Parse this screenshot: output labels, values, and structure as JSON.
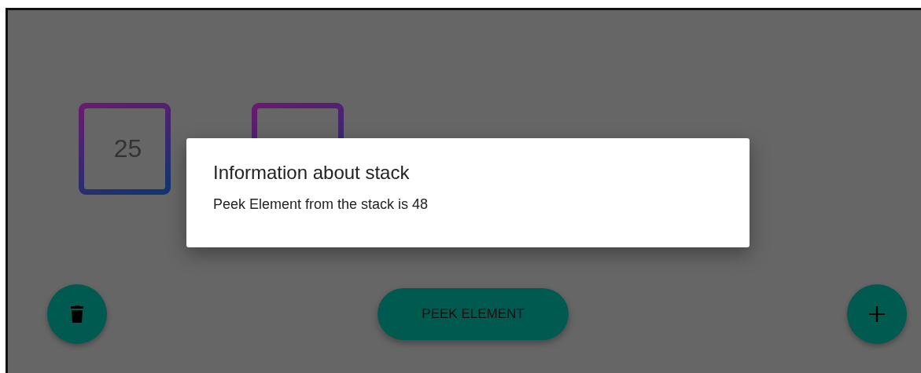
{
  "stack": [
    {
      "kind": "number",
      "value": "25"
    },
    {
      "kind": "covered"
    }
  ],
  "dialog": {
    "title": "Information about stack",
    "message": "Peek Element from the stack is 48"
  },
  "peek_button": {
    "label": "PEEK ELEMENT"
  }
}
